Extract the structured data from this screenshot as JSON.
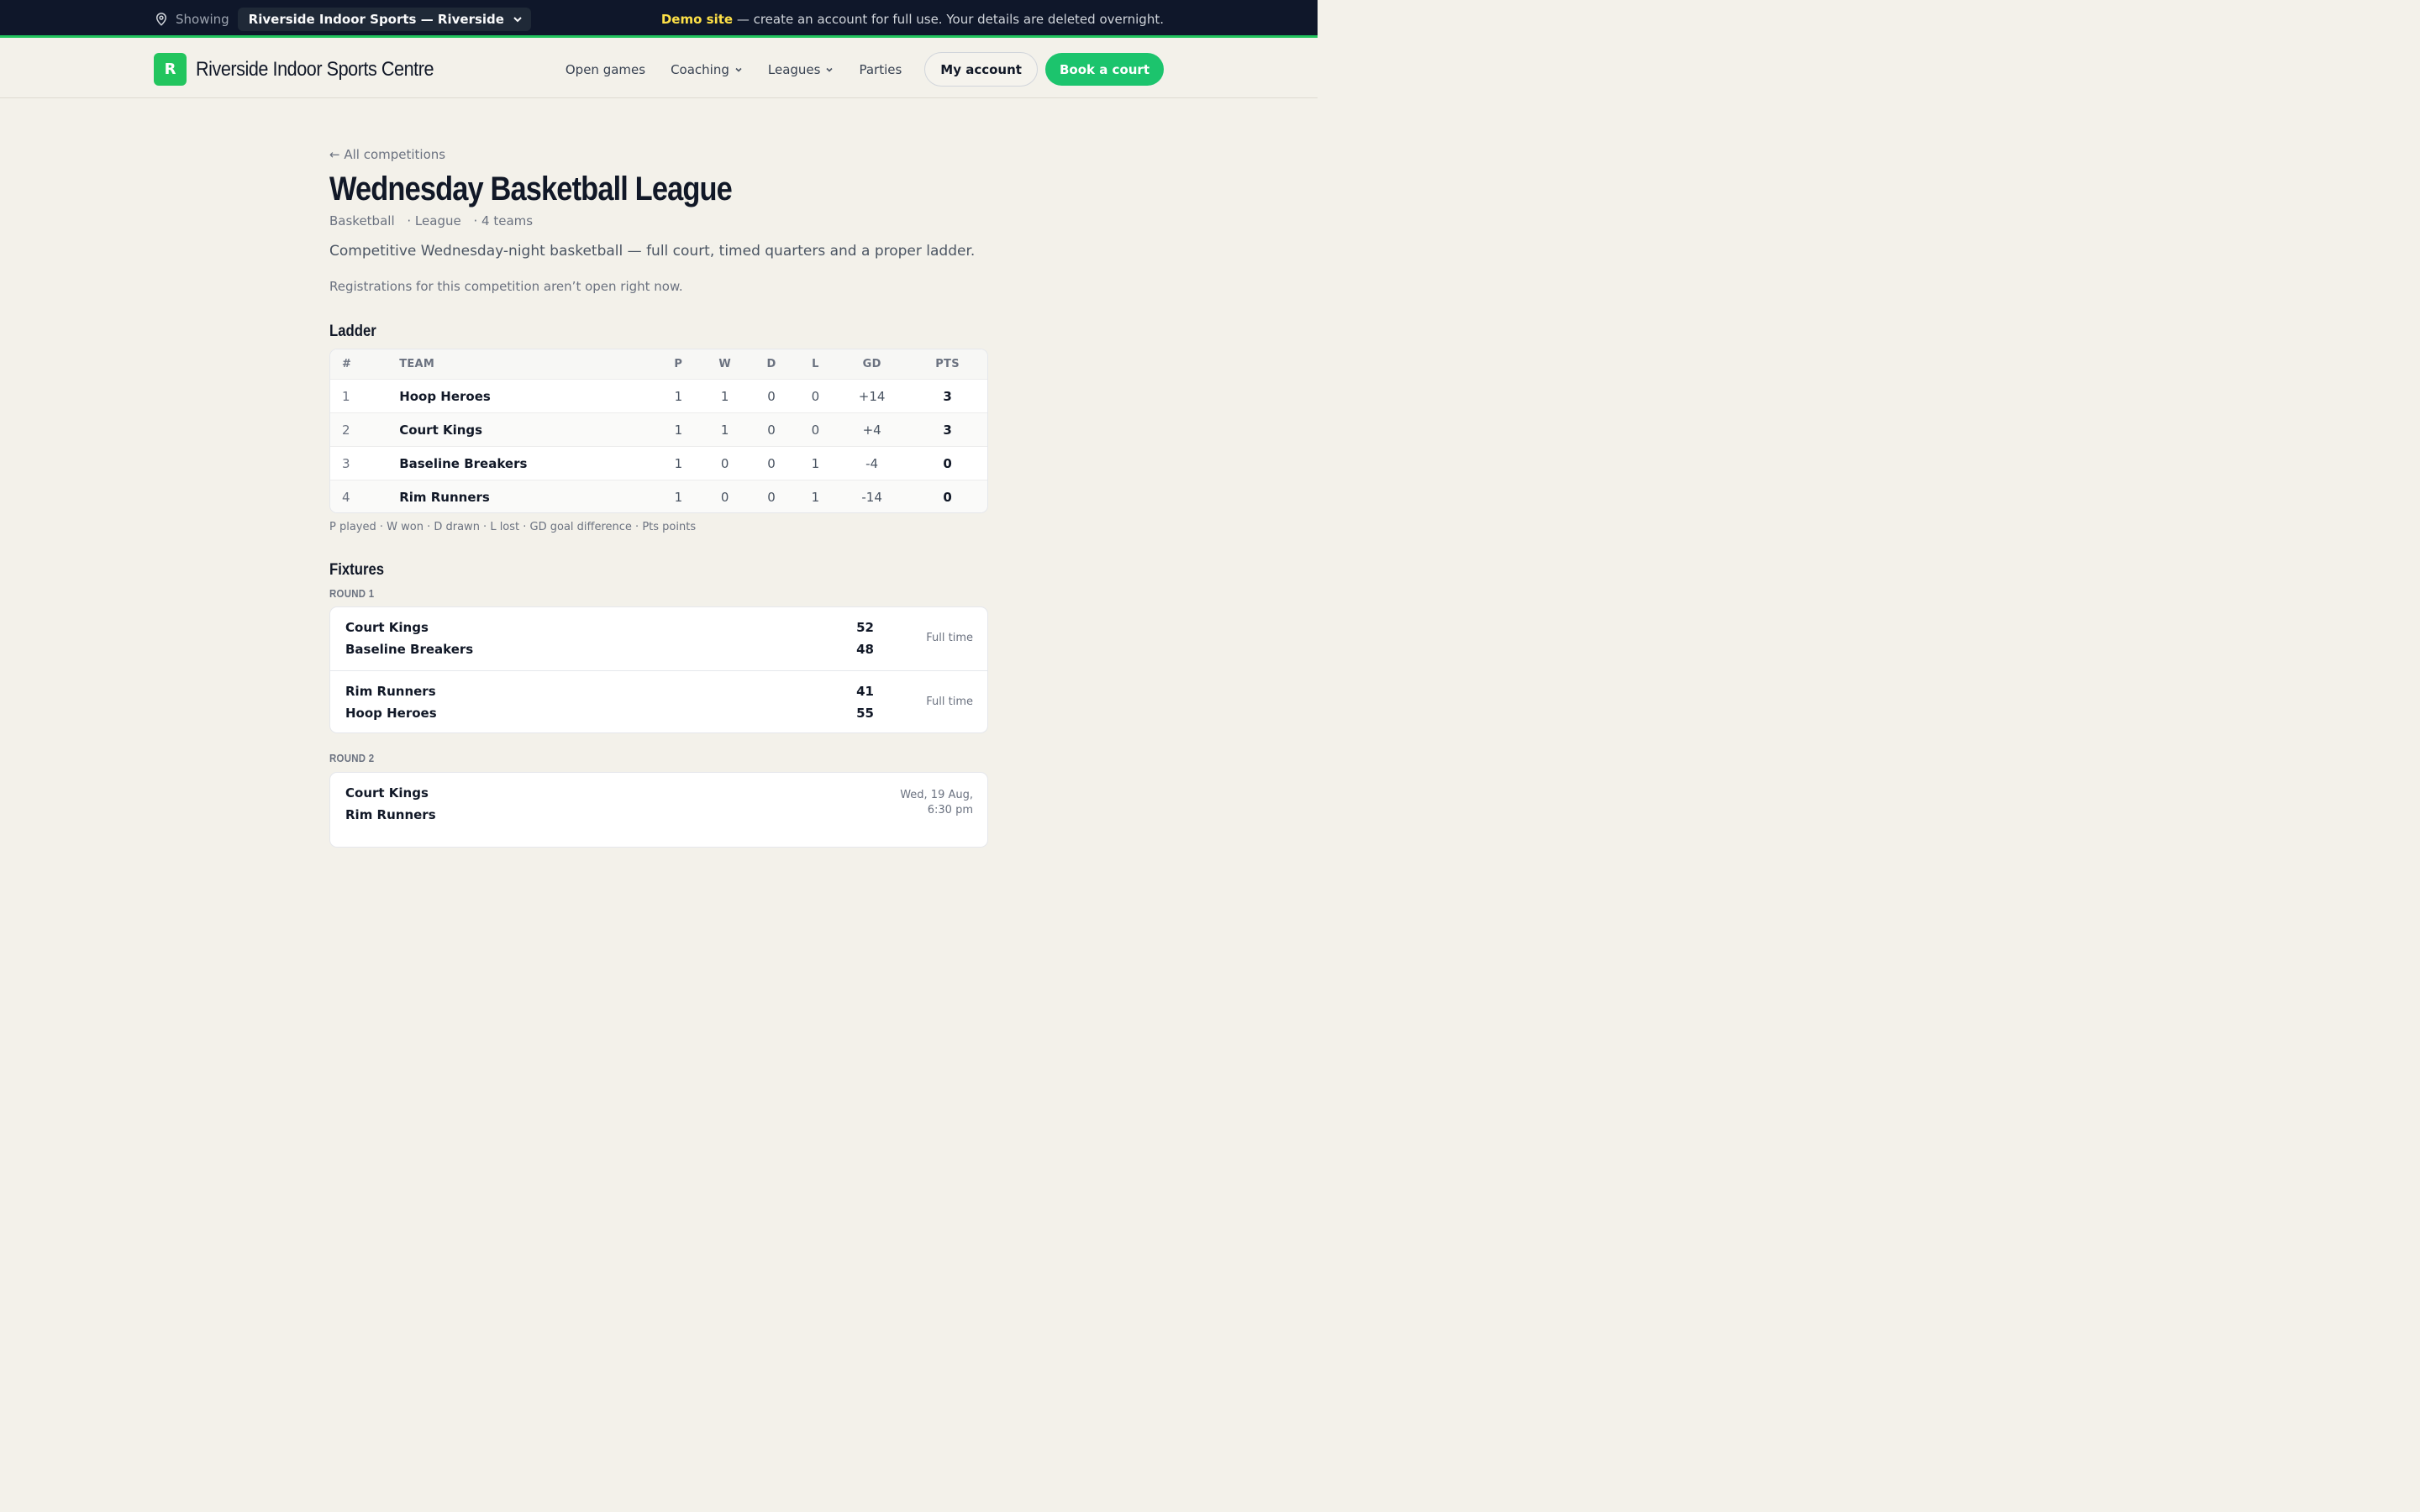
{
  "topbar": {
    "showing_label": "Showing",
    "site_selected": "Riverside Indoor Sports — Riverside",
    "demo_highlight": "Demo site",
    "demo_rest": " — create an account for full use. Your details are deleted overnight."
  },
  "header": {
    "logo_letter": "R",
    "brand": "Riverside Indoor Sports Centre",
    "nav": {
      "open_games": "Open games",
      "coaching": "Coaching",
      "leagues": "Leagues",
      "parties": "Parties"
    },
    "my_account": "My account",
    "book_court": "Book a court"
  },
  "page": {
    "back_link": "← All competitions",
    "title": "Wednesday Basketball League",
    "meta": {
      "sport": "Basketball",
      "format": "· League",
      "teams": "· 4 teams"
    },
    "description": "Competitive Wednesday-night basketball — full court, timed quarters and a proper ladder.",
    "registration_note": "Registrations for this competition aren’t open right now."
  },
  "ladder": {
    "heading": "Ladder",
    "columns": {
      "pos": "#",
      "team": "TEAM",
      "p": "P",
      "w": "W",
      "d": "D",
      "l": "L",
      "gd": "GD",
      "pts": "PTS"
    },
    "rows": [
      {
        "pos": "1",
        "team": "Hoop Heroes",
        "p": "1",
        "w": "1",
        "d": "0",
        "l": "0",
        "gd": "+14",
        "pts": "3"
      },
      {
        "pos": "2",
        "team": "Court Kings",
        "p": "1",
        "w": "1",
        "d": "0",
        "l": "0",
        "gd": "+4",
        "pts": "3"
      },
      {
        "pos": "3",
        "team": "Baseline Breakers",
        "p": "1",
        "w": "0",
        "d": "0",
        "l": "1",
        "gd": "-4",
        "pts": "0"
      },
      {
        "pos": "4",
        "team": "Rim Runners",
        "p": "1",
        "w": "0",
        "d": "0",
        "l": "1",
        "gd": "-14",
        "pts": "0"
      }
    ],
    "legend": "P played · W won · D drawn · L lost · GD goal difference · Pts points"
  },
  "fixtures": {
    "heading": "Fixtures",
    "rounds": [
      {
        "label": "ROUND 1",
        "matches": [
          {
            "home": "Court Kings",
            "home_score": "52",
            "away": "Baseline Breakers",
            "away_score": "48",
            "status": "Full time"
          },
          {
            "home": "Rim Runners",
            "home_score": "41",
            "away": "Hoop Heroes",
            "away_score": "55",
            "status": "Full time"
          }
        ]
      },
      {
        "label": "ROUND 2",
        "matches": [
          {
            "home": "Court Kings",
            "away": "Rim Runners",
            "status_line1": "Wed, 19 Aug,",
            "status_line2": "6:30 pm"
          }
        ]
      }
    ]
  },
  "colors": {
    "topbar_bg": "#0f172a",
    "accent_green": "#22c55e",
    "page_bg": "#f3f1ea",
    "demo_highlight": "#fde047"
  },
  "icons": {
    "location": "map-pin-icon",
    "select_caret": "chevron-down-icon",
    "nav_caret": "chevron-down-icon"
  }
}
